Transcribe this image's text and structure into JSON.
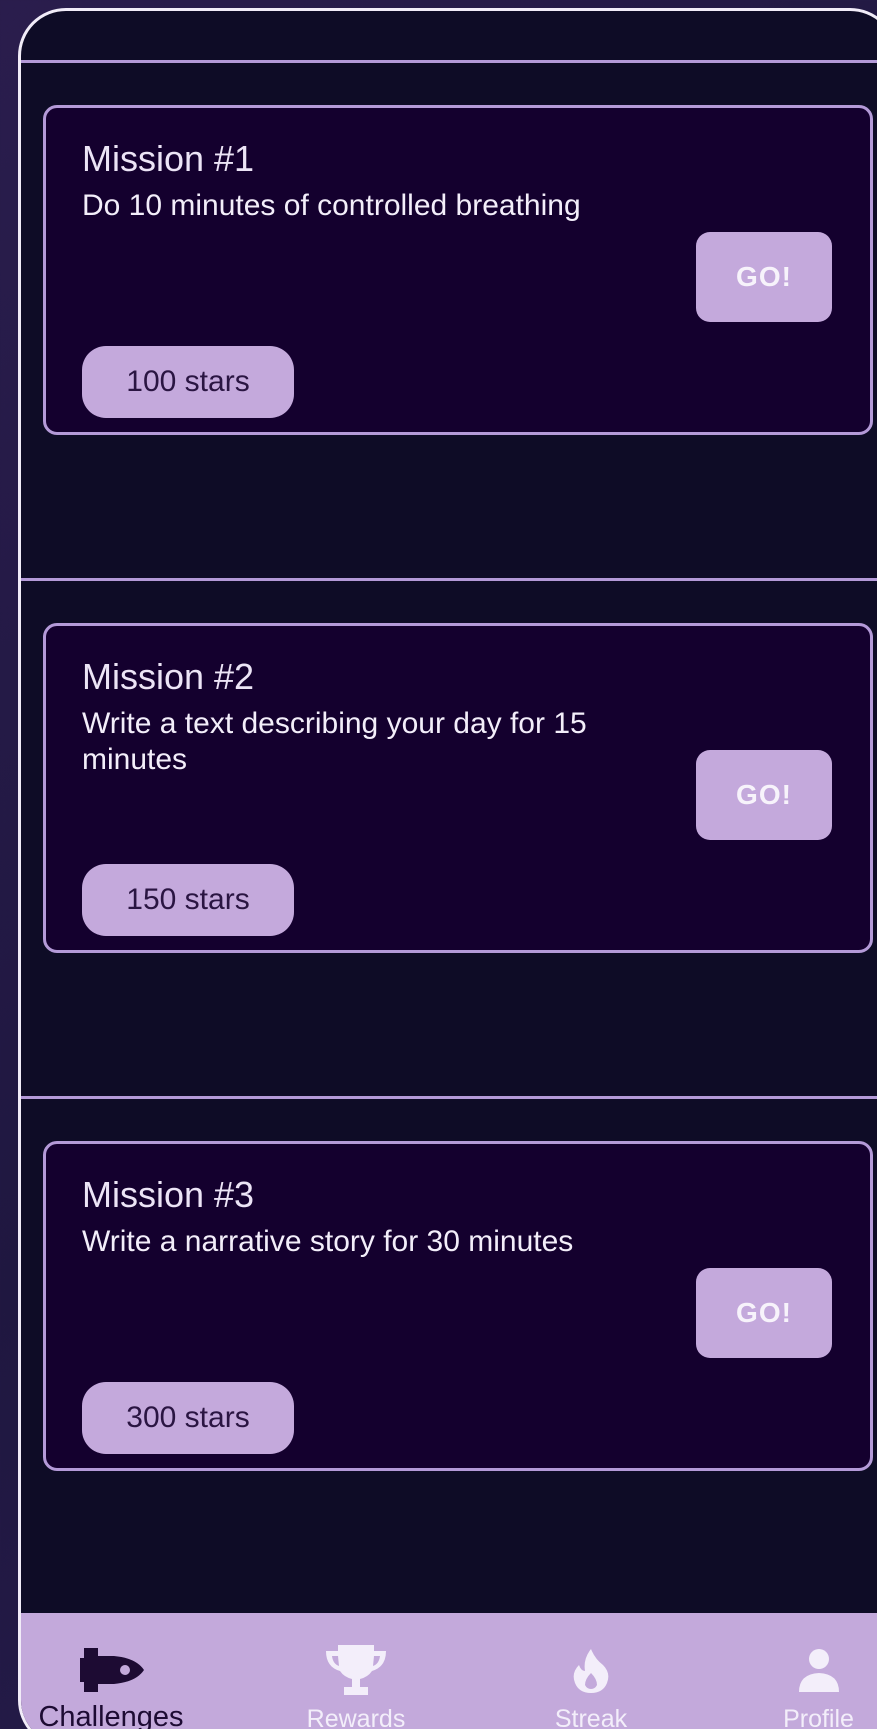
{
  "missions": [
    {
      "title": "Mission #1",
      "description": "Do 10 minutes of controlled breathing",
      "go_label": "GO!",
      "reward": "100 stars"
    },
    {
      "title": "Mission #2",
      "description": "Write a text describing your day for 15 minutes",
      "go_label": "GO!",
      "reward": "150 stars"
    },
    {
      "title": "Mission #3",
      "description": "Write a narrative story for 30 minutes",
      "go_label": "GO!",
      "reward": "300 stars"
    }
  ],
  "tabs": [
    {
      "label": "Challenges",
      "icon": "rocket-icon",
      "active": true
    },
    {
      "label": "Rewards",
      "icon": "trophy-icon",
      "active": false
    },
    {
      "label": "Streak",
      "icon": "flame-icon",
      "active": false
    },
    {
      "label": "Profile",
      "icon": "person-icon",
      "active": false
    }
  ],
  "colors": {
    "background": "#0e0c26",
    "card": "#14002e",
    "accent": "#c4a9dc",
    "border": "#b49ad8"
  }
}
